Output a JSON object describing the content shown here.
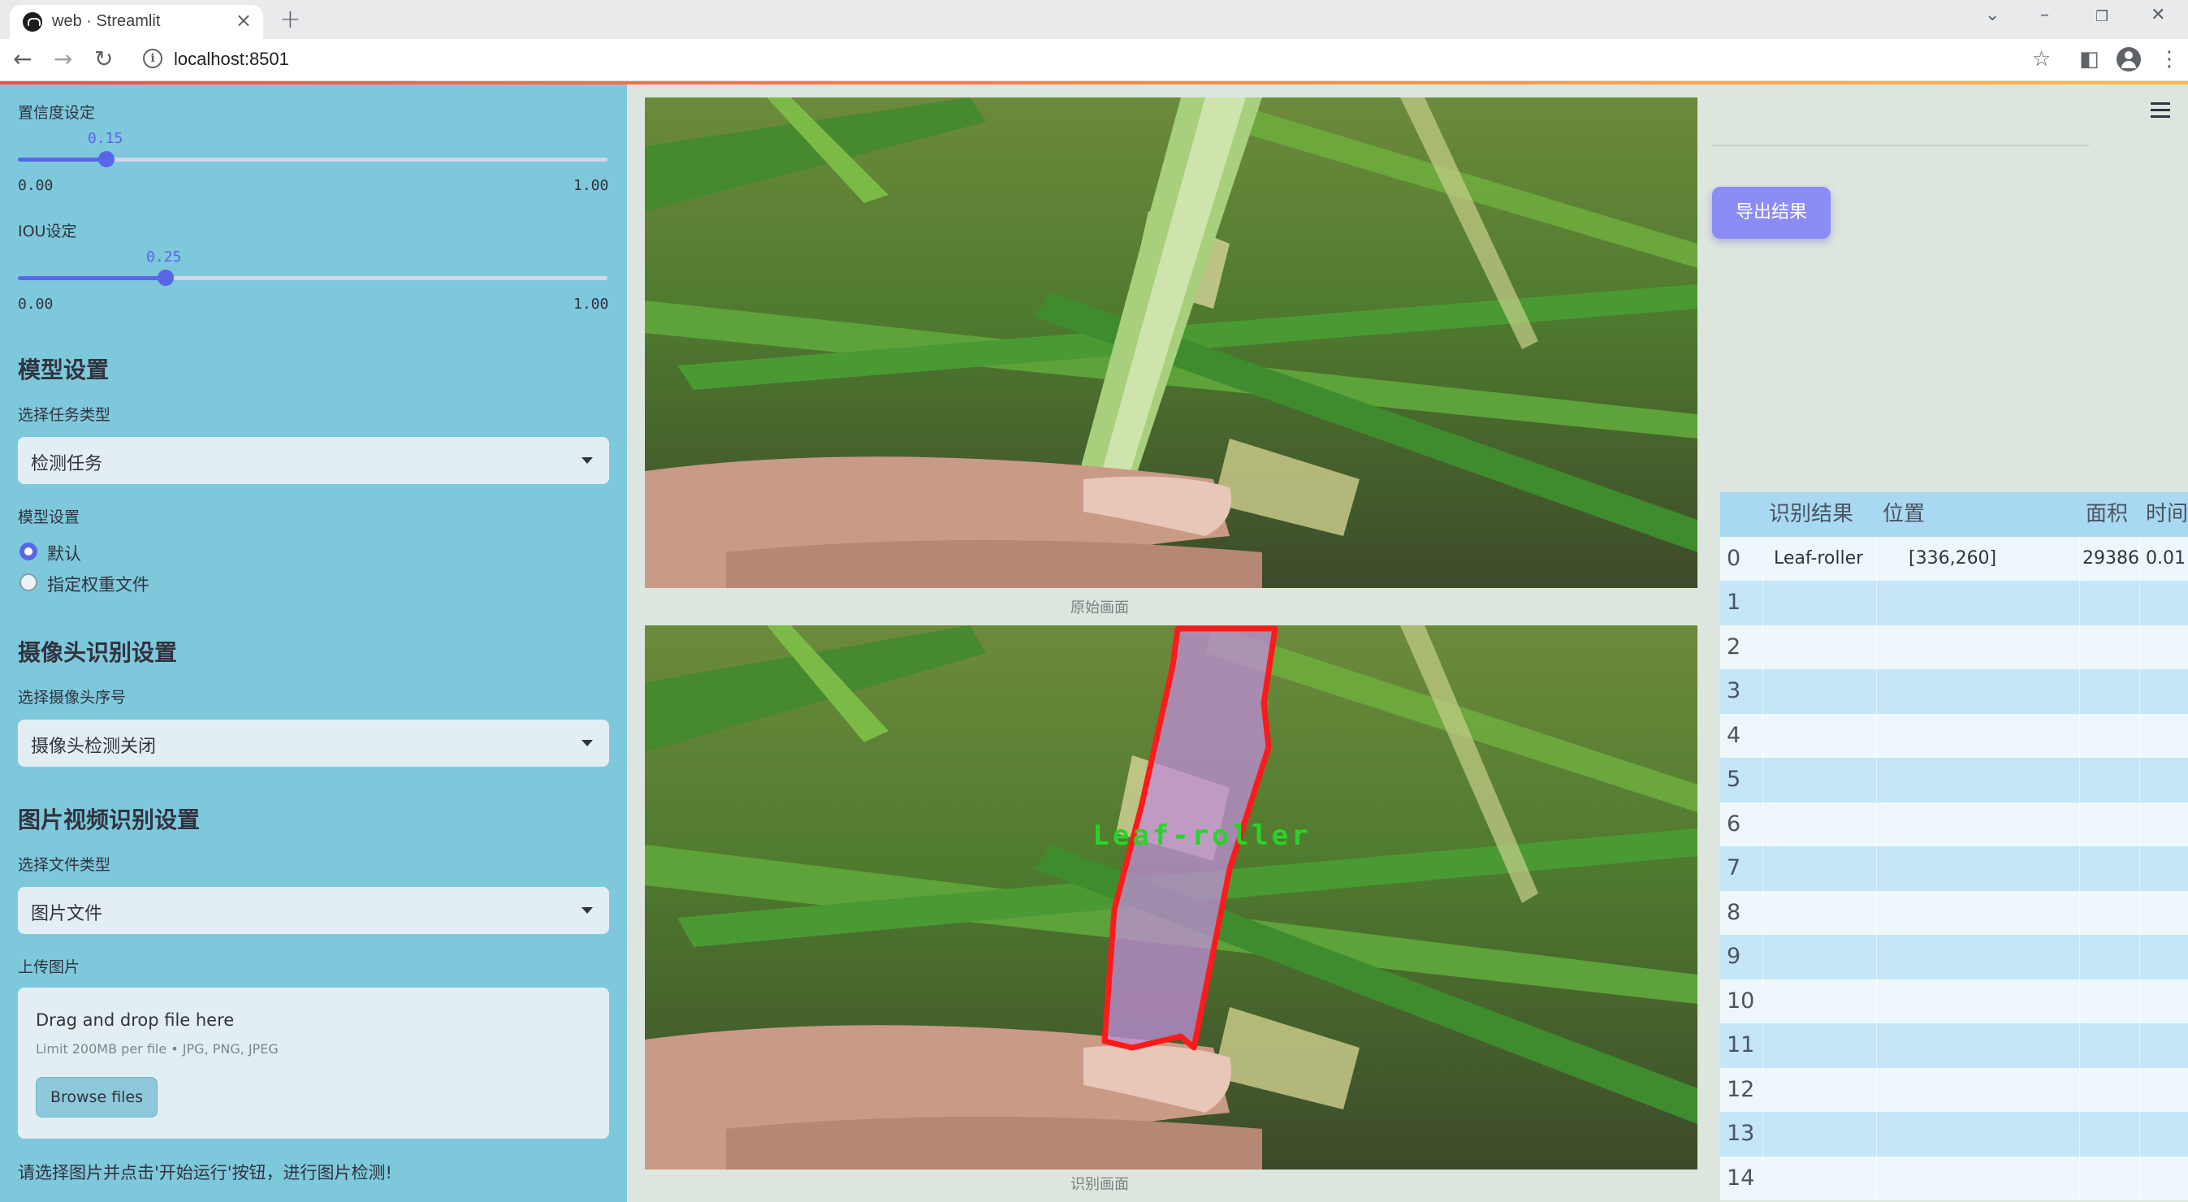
{
  "browser": {
    "tab_title": "web · Streamlit",
    "url": "localhost:8501"
  },
  "sidebar": {
    "confidence": {
      "label": "置信度设定",
      "value": "0.15",
      "min": "0.00",
      "max": "1.00",
      "fraction": 0.15
    },
    "iou": {
      "label": "IOU设定",
      "value": "0.25",
      "min": "0.00",
      "max": "1.00",
      "fraction": 0.25
    },
    "model_section": "模型设置",
    "task_label": "选择任务类型",
    "task_value": "检测任务",
    "model_label": "模型设置",
    "model_options": [
      "默认",
      "指定权重文件"
    ],
    "model_selected": 0,
    "camera_section": "摄像头识别设置",
    "camera_label": "选择摄像头序号",
    "camera_value": "摄像头检测关闭",
    "media_section": "图片视频识别设置",
    "file_type_label": "选择文件类型",
    "file_type_value": "图片文件",
    "upload_label": "上传图片",
    "upload_title": "Drag and drop file here",
    "upload_limit": "Limit 200MB per file • JPG, PNG, JPEG",
    "browse_label": "Browse files",
    "hint": "请选择图片并点击'开始运行'按钮，进行图片检测!"
  },
  "main": {
    "original_caption": "原始画面",
    "result_caption": "识别画面",
    "detection_label": "Leaf-roller",
    "export_label": "导出结果",
    "table": {
      "headers": [
        "",
        "识别结果",
        "位置",
        "面积",
        "时间"
      ],
      "rows": [
        [
          "0",
          "Leaf-roller",
          "[336,260]",
          "29386",
          "0.01"
        ],
        [
          "1",
          "",
          "",
          "",
          ""
        ],
        [
          "2",
          "",
          "",
          "",
          ""
        ],
        [
          "3",
          "",
          "",
          "",
          ""
        ],
        [
          "4",
          "",
          "",
          "",
          ""
        ],
        [
          "5",
          "",
          "",
          "",
          ""
        ],
        [
          "6",
          "",
          "",
          "",
          ""
        ],
        [
          "7",
          "",
          "",
          "",
          ""
        ],
        [
          "8",
          "",
          "",
          "",
          ""
        ],
        [
          "9",
          "",
          "",
          "",
          ""
        ],
        [
          "10",
          "",
          "",
          "",
          ""
        ],
        [
          "11",
          "",
          "",
          "",
          ""
        ],
        [
          "12",
          "",
          "",
          "",
          ""
        ],
        [
          "13",
          "",
          "",
          "",
          ""
        ],
        [
          "14",
          "",
          "",
          "",
          ""
        ]
      ]
    }
  },
  "colors": {
    "sidebar_bg": "#7ec8dc",
    "accent": "#5a66e6",
    "export_button": "#8c8cf5",
    "table_header": "#a9d8f2",
    "table_row_alt": "#c4e6f6",
    "table_row": "#eef8fc",
    "mask_outline": "#ff1a1a",
    "mask_fill": "#c08cd8",
    "label_green": "#2ad32a"
  }
}
